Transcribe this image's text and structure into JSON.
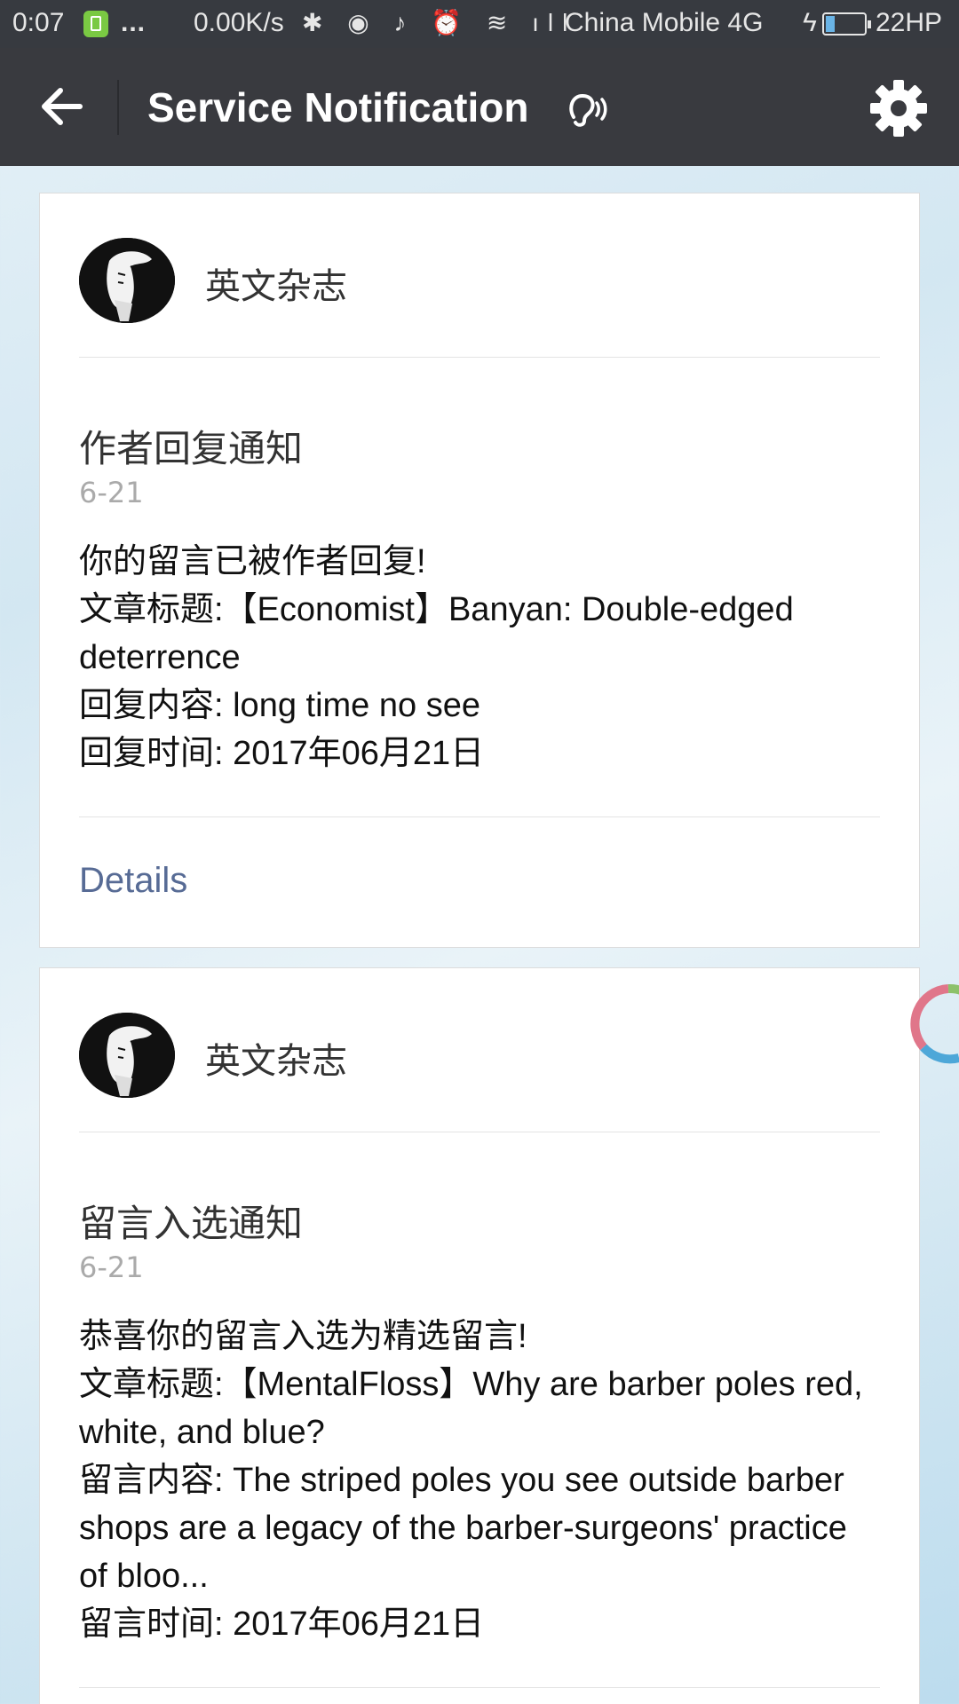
{
  "status_bar": {
    "time": "0:07",
    "dots": "...",
    "speed": "0.00K/s",
    "icons": "✱ ◉ ♪ ⏰ ≋ ıll",
    "carrier": "China Mobile 4G",
    "bolt": "ϟ",
    "battery_level": "22HP"
  },
  "nav": {
    "title": "Service Notification",
    "back_icon": "back-arrow-icon",
    "ear_icon": "earpiece-icon",
    "settings_icon": "gear-icon"
  },
  "notifications": [
    {
      "account_name": "英文杂志",
      "title": "作者回复通知",
      "date": "6-21",
      "lines": [
        "你的留言已被作者回复!",
        "文章标题:【Economist】Banyan: Double-edged deterrence",
        "回复内容: long time no see",
        "回复时间: 2017年06月21日"
      ],
      "details_label": "Details"
    },
    {
      "account_name": "英文杂志",
      "title": "留言入选通知",
      "date": "6-21",
      "lines": [
        "恭喜你的留言入选为精选留言!",
        "文章标题:【MentalFloss】Why are barber poles red, white, and blue?",
        "留言内容: The striped poles you see outside barber shops are a legacy of the barber-surgeons' practice of bloo...",
        "留言时间: 2017年06月21日"
      ]
    }
  ],
  "colors": {
    "nav_bg": "#393a3f",
    "link": "#576b95",
    "date_gray": "#aaaaaa"
  }
}
